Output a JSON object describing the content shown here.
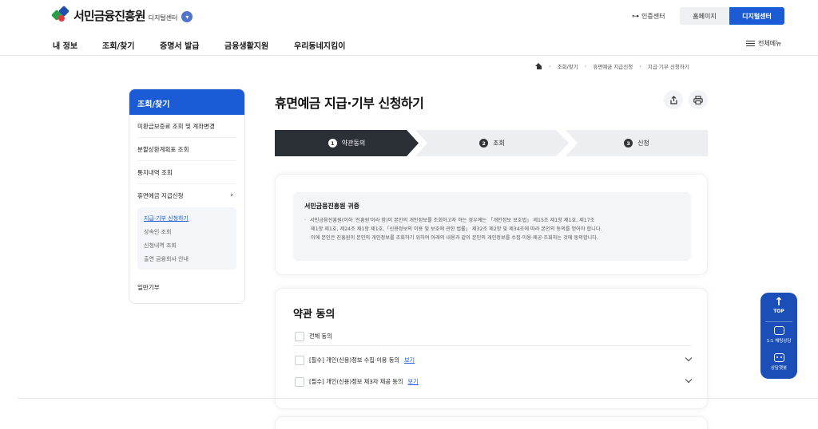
{
  "header": {
    "logo_name": "서민금융진흥원",
    "logo_sub": "디지털센터",
    "cert_label": "인증센터",
    "home_button": "홈페이지",
    "digital_button": "디지털센터"
  },
  "gnb": {
    "items": [
      "내 정보",
      "조회/찾기",
      "증명서 발급",
      "금융생활지원",
      "우리동네지킴이"
    ],
    "all_menu": "전체메뉴"
  },
  "breadcrumb": [
    "조회/찾기",
    "휴면예금 지급신청",
    "지급·기부 신청하기"
  ],
  "sidebar": {
    "title": "조회/찾기",
    "items": [
      "미환급보증료 조회 및 계좌변경",
      "분할상환계획표 조회",
      "통지내역 조회",
      "휴면예금 지급신청"
    ],
    "sub_items": [
      "지급·기부 신청하기",
      "상속인 조회",
      "신청내역 조회",
      "출연 금융회사 안내"
    ],
    "last_item": "일반기부"
  },
  "main": {
    "title": "휴면예금 지급·기부 신청하기",
    "steps": [
      {
        "num": "1",
        "label": "약관동의"
      },
      {
        "num": "2",
        "label": "조회"
      },
      {
        "num": "3",
        "label": "신청"
      }
    ],
    "notice": {
      "title": "서민금융진흥원 귀중",
      "lines": [
        "서민금융진흥원(이하 '진흥원'이라 함)이 본인의 개인정보를 조회하고자 하는 경우에는 「개인정보 보호법」 제15조 제1항 제1호, 제17조",
        "제1항 제1호, 제24조 제1항 제1호,「신용정보의 이용 및 보호에 관한 법률」 제32조 제2항 및 제34조에 따라 본인의 동의를 얻어야 합니다.",
        "이에 본인은 진흥원이 본인의 개인정보를 조회하기 위하여 아래의 내용과 같이 본인의 개인정보를 수집·이용·제공·조회하는 것에 동의합니다."
      ]
    },
    "terms": {
      "title": "약관 동의",
      "all_agree": "전체 동의",
      "rows": [
        {
          "label": "[필수] 개인(신용)정보 수집·이용 동의",
          "link": "보기"
        },
        {
          "label": "[필수] 개인(신용)정보 제3자 제공 동의",
          "link": "보기"
        }
      ]
    }
  },
  "floating": {
    "top_label": "TOP",
    "chat_label": "1:1 채팅상담",
    "bot_label": "상담챗봇"
  },
  "colors": {
    "accent": "#1b5bd6",
    "dark_step": "#2b2f36",
    "float_bg": "#1b4fb7"
  }
}
